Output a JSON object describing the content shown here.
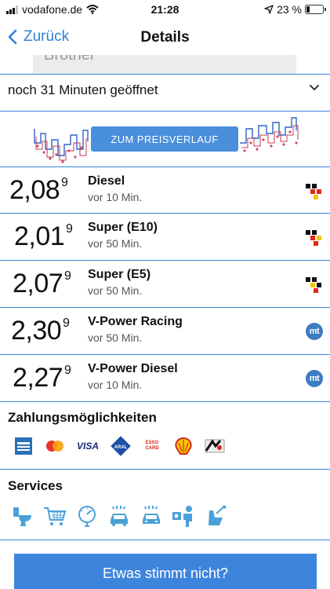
{
  "status_bar": {
    "carrier": "vodafone.de",
    "time": "21:28",
    "battery": "23 %",
    "battery_level": 0.23
  },
  "nav": {
    "back_label": "Zurück",
    "title": "Details"
  },
  "address_card": {
    "partial_text": "Brother"
  },
  "hours": {
    "label": "noch 31 Minuten geöffnet"
  },
  "price_chart": {
    "button_label": "ZUM PREISVERLAUF"
  },
  "prices": [
    {
      "price": "2,08",
      "decimal": "9",
      "fuel": "Diesel",
      "updated": "vor 10 Min.",
      "source_icon": "mts-flag-icon"
    },
    {
      "price": "2,01",
      "decimal": "9",
      "fuel": "Super (E10)",
      "updated": "vor 50 Min.",
      "source_icon": "mts-flag-icon"
    },
    {
      "price": "2,07",
      "decimal": "9",
      "fuel": "Super (E5)",
      "updated": "vor 50 Min.",
      "source_icon": "mts-flag-icon"
    },
    {
      "price": "2,30",
      "decimal": "9",
      "fuel": "V-Power Racing",
      "updated": "vor 50 Min.",
      "source_icon": "mt-icon",
      "source_label": "mt"
    },
    {
      "price": "2,27",
      "decimal": "9",
      "fuel": "V-Power Diesel",
      "updated": "vor 10 Min.",
      "source_icon": "mt-icon",
      "source_label": "mt"
    }
  ],
  "payment": {
    "title": "Zahlungsmöglichkeiten",
    "methods": [
      {
        "icon": "amex-icon"
      },
      {
        "icon": "mastercard-icon"
      },
      {
        "icon": "visa-icon",
        "label": "VISA"
      },
      {
        "icon": "aral-card-icon",
        "label": "ARAL"
      },
      {
        "icon": "esso-card-icon",
        "label": "ESSO CARD"
      },
      {
        "icon": "shell-icon"
      },
      {
        "icon": "dkv-card-icon"
      }
    ]
  },
  "services": {
    "title": "Services",
    "items": [
      {
        "icon": "toilet-icon"
      },
      {
        "icon": "shopping-cart-icon"
      },
      {
        "icon": "air-pressure-icon"
      },
      {
        "icon": "car-wash-icon"
      },
      {
        "icon": "self-car-wash-icon"
      },
      {
        "icon": "cash-payment-service-icon"
      },
      {
        "icon": "vacuum-seat-cleaning-icon"
      }
    ]
  },
  "cta": {
    "label": "Etwas stimmt nicht?"
  },
  "colors": {
    "accent": "#3d85dc",
    "divider": "#3a84dc",
    "text": "#111111",
    "secondary": "#555555"
  }
}
